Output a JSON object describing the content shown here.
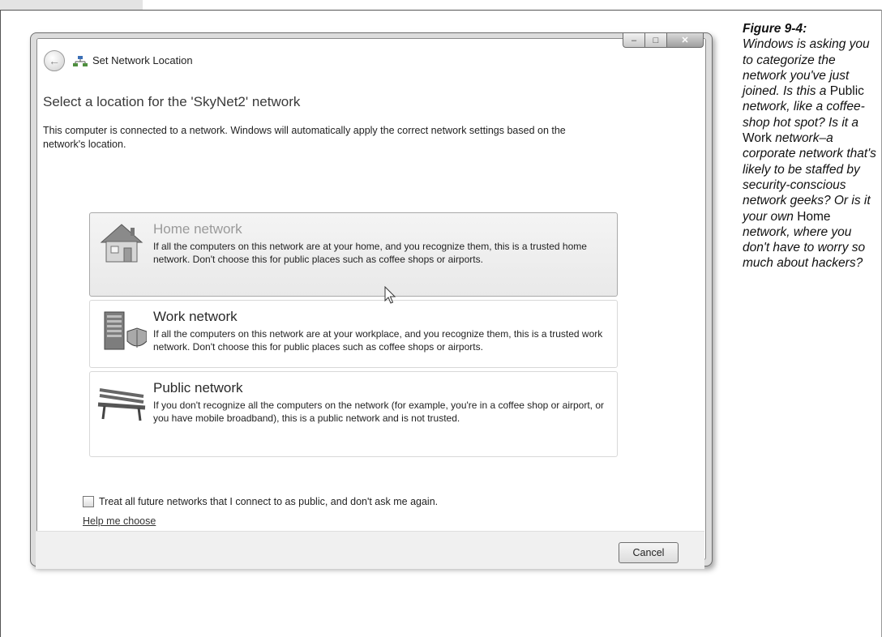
{
  "window": {
    "title": "Set Network Location",
    "heading": "Select a location for the 'SkyNet2' network",
    "intro": "This computer is connected to a network. Windows will automatically apply the correct network settings based on the network's location.",
    "options": [
      {
        "title": "Home network",
        "description": "If all the computers on this network are at your home, and you recognize them, this is a trusted home network.  Don't choose this for public places such as coffee shops or airports.",
        "icon": "house-icon"
      },
      {
        "title": "Work network",
        "description": "If all the computers on this network are at your workplace, and you recognize them, this is a trusted work network.  Don't choose this for public places such as coffee shops or airports.",
        "icon": "office-building-icon"
      },
      {
        "title": "Public network",
        "description": "If you don't recognize all the computers on the network (for example, you're in a coffee shop or airport, or you have mobile broadband), this is a public network and is not trusted.",
        "icon": "park-bench-icon"
      }
    ],
    "checkbox_label": "Treat all future networks that I connect to as public, and don't ask me again.",
    "checkbox_checked": false,
    "help_link": "Help me choose",
    "cancel_label": "Cancel"
  },
  "caption": {
    "figure_label": "Figure 9-4:",
    "text_parts": [
      {
        "t": "Windows is asking you to categorize the network you've just joined. Is this a ",
        "i": true
      },
      {
        "t": "Public",
        "i": false
      },
      {
        "t": " network, like a coffee-shop hot spot? Is it a ",
        "i": true
      },
      {
        "t": "Work",
        "i": false
      },
      {
        "t": " network–a corporate network that's likely to be staffed by security-conscious network geeks? Or is it your own ",
        "i": true
      },
      {
        "t": "Home",
        "i": false
      },
      {
        "t": " network, where you don't have to worry so much about hackers?",
        "i": true
      }
    ]
  },
  "colors": {
    "window_frame": "#dcdcdc",
    "highlight_option": "#ececec",
    "footer": "#f0f0f0"
  }
}
